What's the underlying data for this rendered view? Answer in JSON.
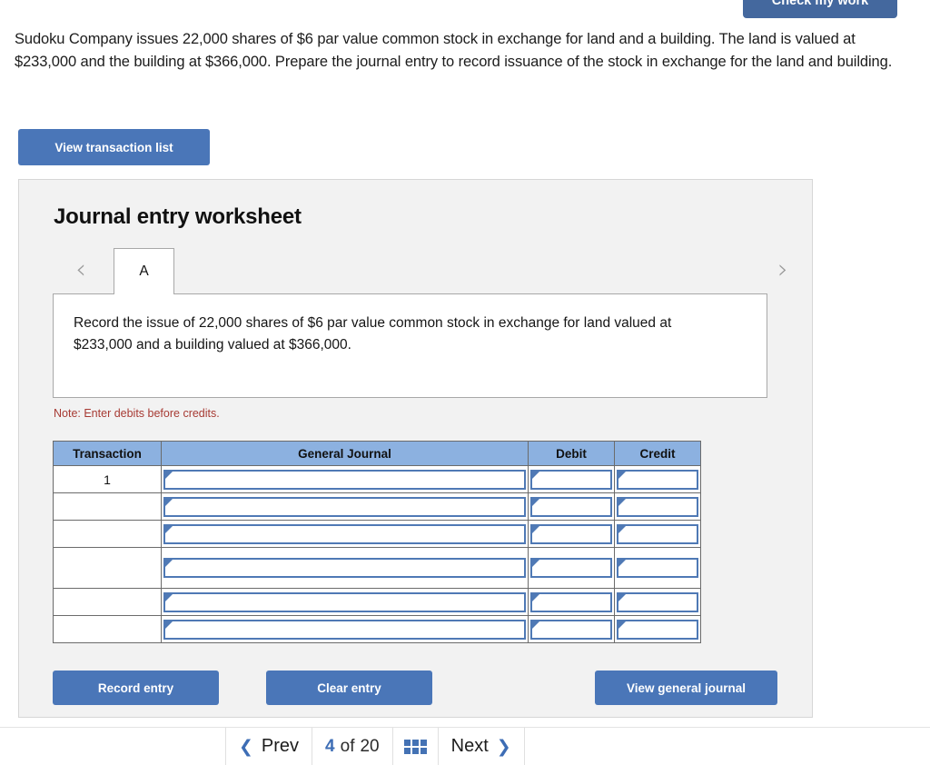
{
  "check_work": {
    "label": "Check my work"
  },
  "question": {
    "text": "Sudoku Company issues 22,000 shares of $6 par value common stock in exchange for land and a building. The land is valued at $233,000 and the building at $366,000. Prepare the journal entry to record issuance of the stock in exchange for the land and building."
  },
  "toolbar": {
    "view_transaction_list": "View transaction list"
  },
  "worksheet": {
    "title": "Journal entry worksheet",
    "prev_arrow": "‹",
    "next_arrow": "›",
    "tabs": [
      {
        "label": "A",
        "active": true
      }
    ],
    "instruction": "Record the issue of 22,000 shares of $6 par value common stock in exchange for land valued at $233,000 and a building valued at $366,000.",
    "note": "Note: Enter debits before credits."
  },
  "table": {
    "headers": [
      "Transaction",
      "General Journal",
      "Debit",
      "Credit"
    ],
    "rows": [
      {
        "transaction": "1",
        "general_journal": "",
        "debit": "",
        "credit": "",
        "size": "sm"
      },
      {
        "transaction": "",
        "general_journal": "",
        "debit": "",
        "credit": "",
        "size": "sm"
      },
      {
        "transaction": "",
        "general_journal": "",
        "debit": "",
        "credit": "",
        "size": "sm"
      },
      {
        "transaction": "",
        "general_journal": "",
        "debit": "",
        "credit": "",
        "size": "lg"
      },
      {
        "transaction": "",
        "general_journal": "",
        "debit": "",
        "credit": "",
        "size": "sm"
      },
      {
        "transaction": "",
        "general_journal": "",
        "debit": "",
        "credit": "",
        "size": "sm"
      }
    ]
  },
  "actions": {
    "record_entry": "Record entry",
    "clear_entry": "Clear entry",
    "view_general_journal": "View general journal"
  },
  "pagination": {
    "prev_label": "Prev",
    "prev_chevron": "❮",
    "current_page": "4",
    "of_label": "of",
    "total_pages": "20",
    "next_label": "Next",
    "next_chevron": "❯"
  },
  "colors": {
    "button_blue": "#4a76b8",
    "check_work_blue": "#44689e",
    "table_header_blue": "#8cb1e0",
    "input_border_blue": "#4f79b5",
    "note_red": "#a73a33",
    "panel_bg": "#f2f2f2",
    "nav_accent": "#3d6db5"
  }
}
